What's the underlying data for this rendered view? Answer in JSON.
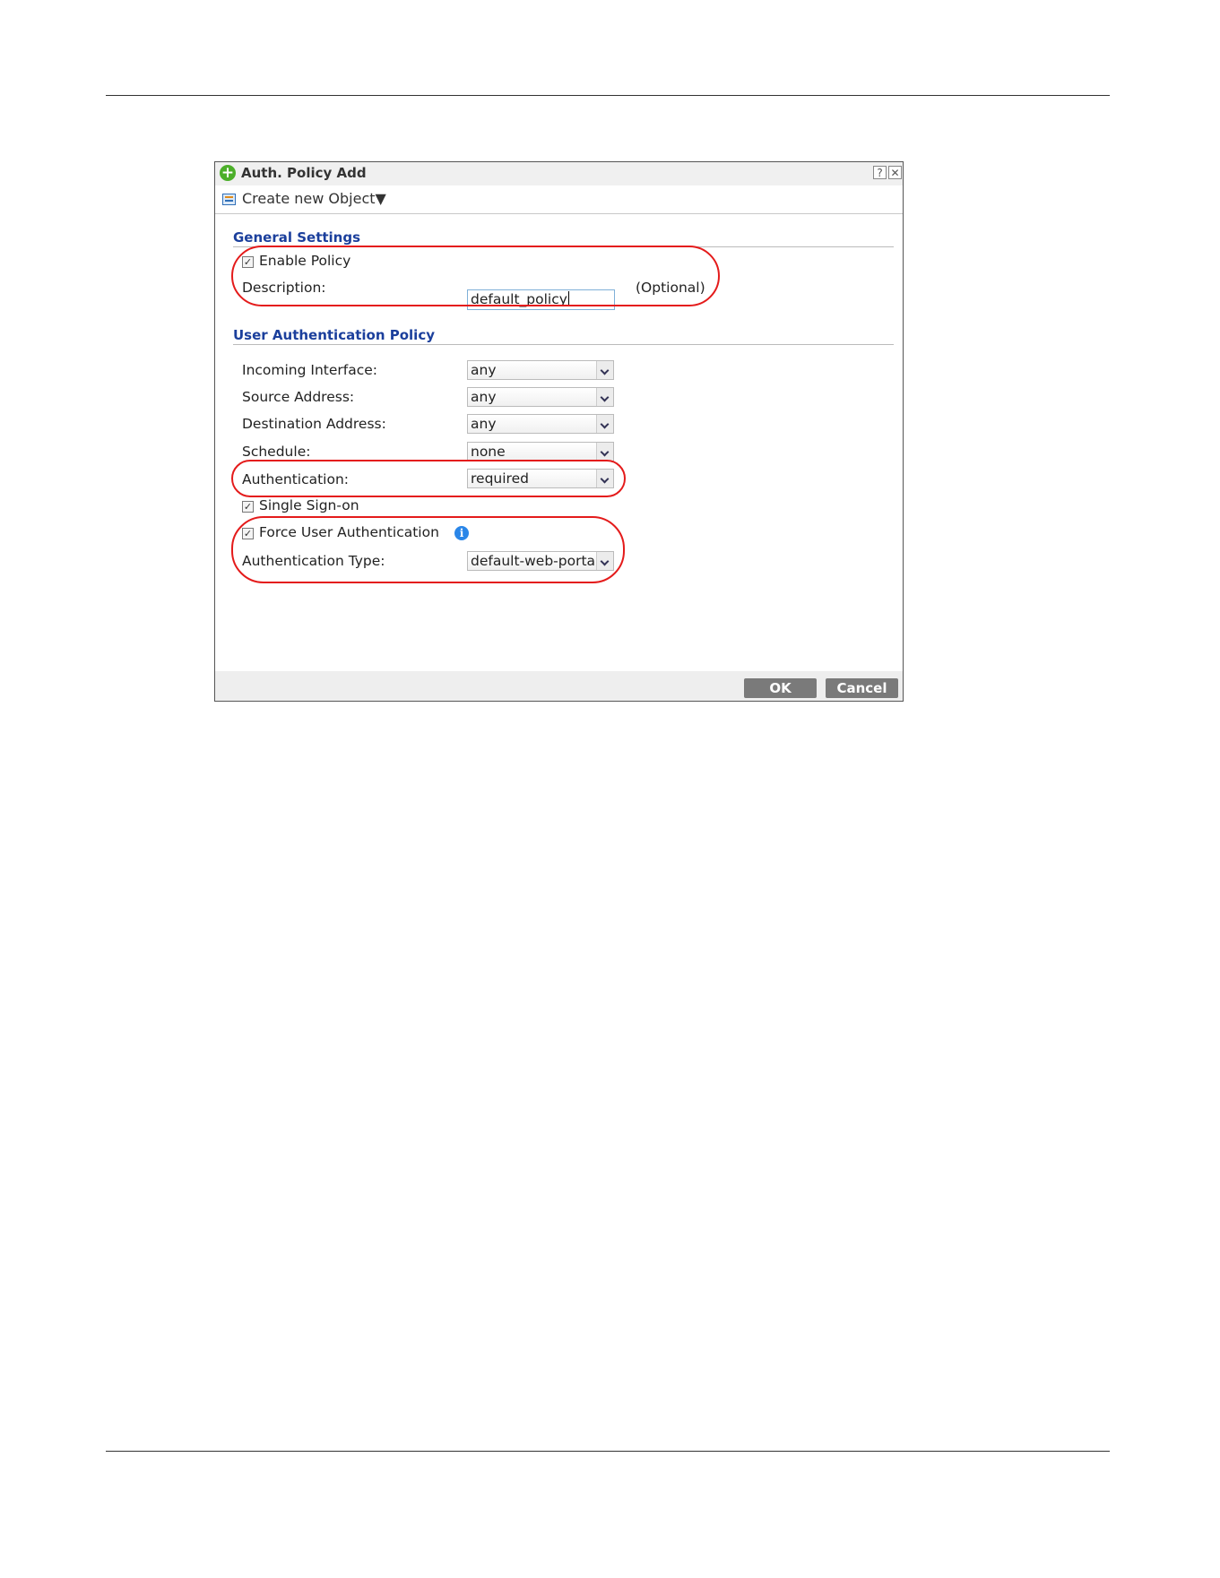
{
  "dialog": {
    "title": "Auth. Policy Add",
    "help_glyph": "?",
    "close_glyph": "✕"
  },
  "toolbar": {
    "create_label": "Create new Object▼"
  },
  "general": {
    "heading": "General Settings",
    "enable_label": "Enable Policy",
    "enable_checked": true,
    "description_label": "Description:",
    "description_value": "default_policy",
    "optional_label": "(Optional)"
  },
  "user_auth": {
    "heading": "User Authentication Policy",
    "incoming_label": "Incoming Interface:",
    "incoming_value": "any",
    "source_label": "Source Address:",
    "source_value": "any",
    "destination_label": "Destination Address:",
    "destination_value": "any",
    "schedule_label": "Schedule:",
    "schedule_value": "none",
    "authentication_label": "Authentication:",
    "authentication_value": "required",
    "sso_label": "Single Sign-on",
    "sso_checked": true,
    "force_label": "Force User Authentication",
    "force_checked": true,
    "auth_type_label": "Authentication Type:",
    "auth_type_value": "default-web-portal"
  },
  "buttons": {
    "ok": "OK",
    "cancel": "Cancel"
  },
  "colors": {
    "highlight": "#e41b1b",
    "section_heading": "#1b3f9c",
    "button": "#7a7a7a",
    "info_icon": "#2a86e8"
  }
}
